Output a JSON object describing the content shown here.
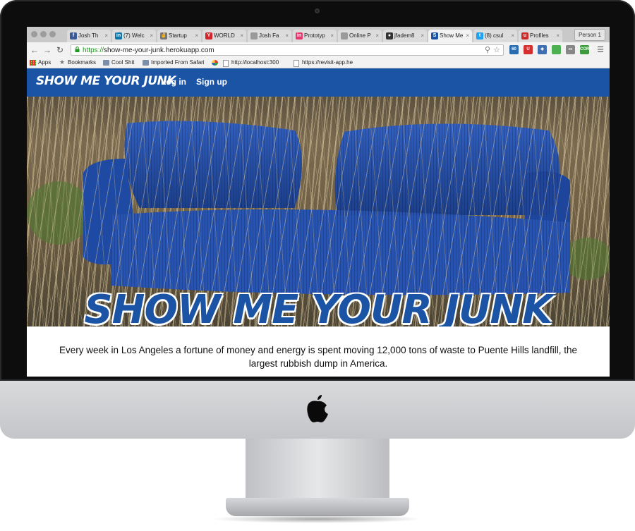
{
  "browser": {
    "tabs": [
      {
        "label": "Josh Th",
        "icon": "facebook-icon",
        "color": "#3b5998",
        "glyph": "f"
      },
      {
        "label": "(7) Welc",
        "icon": "linkedin-icon",
        "color": "#0e76a8",
        "glyph": "in"
      },
      {
        "label": "Startup",
        "icon": "victory-hand-icon",
        "color": "#777777",
        "glyph": "✌"
      },
      {
        "label": "WORLD",
        "icon": "y-logo-icon",
        "color": "#d4232b",
        "glyph": "Y"
      },
      {
        "label": "Josh Fa",
        "icon": "page-icon",
        "color": "#9a9a9a",
        "glyph": ""
      },
      {
        "label": "Prototyp",
        "icon": "invision-icon",
        "color": "#e8386d",
        "glyph": "in"
      },
      {
        "label": "Online P",
        "icon": "page-icon",
        "color": "#9a9a9a",
        "glyph": ""
      },
      {
        "label": "jfadem8",
        "icon": "github-icon",
        "color": "#333333",
        "glyph": "●"
      },
      {
        "label": "Show Me",
        "icon": "site-s-icon",
        "color": "#1b54a5",
        "glyph": "S",
        "active": true
      },
      {
        "label": "(8) csul",
        "icon": "twitter-icon",
        "color": "#1da1f2",
        "glyph": "t"
      },
      {
        "label": "Profiles",
        "icon": "profiles-icon",
        "color": "#cc2b2b",
        "glyph": "u"
      }
    ],
    "person": "Person 1",
    "url_scheme": "https://",
    "url_rest": "show-me-your-junk.herokuapp.com",
    "bookmarks": [
      {
        "label": "Apps",
        "icon": "apps-grid-icon"
      },
      {
        "label": "Bookmarks",
        "icon": "star-icon"
      },
      {
        "label": "Cool Shit",
        "icon": "folder-icon"
      },
      {
        "label": "Imported From Safari",
        "icon": "folder-icon"
      },
      {
        "label": "",
        "icon": "pinwheel-icon"
      },
      {
        "label": "http://localhost:300",
        "icon": "page-icon"
      },
      {
        "label": "https://revisit-app.he",
        "icon": "page-icon"
      }
    ],
    "extensions": [
      {
        "name": "ext-60-icon",
        "text": "60",
        "color": "#2b6cb0"
      },
      {
        "name": "ext-shield-icon",
        "text": "U",
        "color": "#d32f2f"
      },
      {
        "name": "ext-map-icon",
        "text": "◈",
        "color": "#3f6fb0"
      },
      {
        "name": "ext-green-icon",
        "text": "",
        "color": "#4caf50"
      },
      {
        "name": "ext-cast-icon",
        "text": "▭",
        "color": "#888888"
      },
      {
        "name": "ext-cors-icon",
        "text": "CORS",
        "color": "#3d9a3d"
      }
    ]
  },
  "site": {
    "brand": "SHOW ME YOUR JUNK",
    "nav": {
      "login": "Log in",
      "signup": "Sign up"
    },
    "hero_title": "SHOW ME YOUR JUNK",
    "intro": "Every week in Los Angeles a fortune of money and energy is spent moving 12,000 tons of waste to Puente Hills landfill, the largest rubbish dump in America.",
    "colors": {
      "brand_blue": "#1b54a5",
      "navbar": "#1b54a5"
    }
  }
}
